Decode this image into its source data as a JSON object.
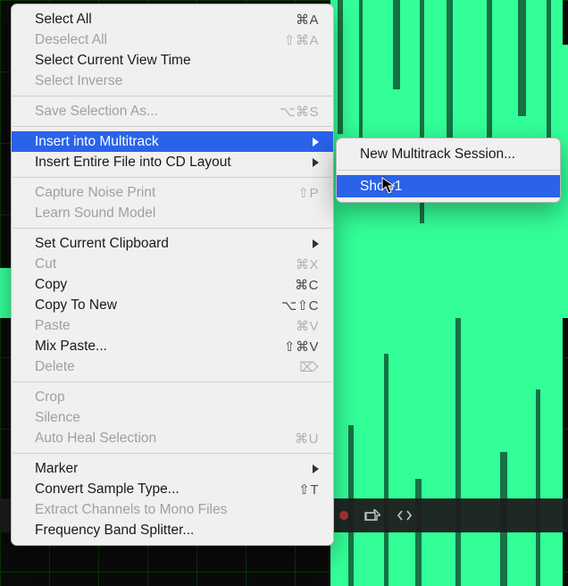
{
  "colors": {
    "highlight": "#2a62ea",
    "waveform": "#33ff99",
    "grid": "#0a5a2a"
  },
  "menu": {
    "groups": [
      [
        {
          "label": "Select All",
          "shortcut": "⌘A",
          "enabled": true
        },
        {
          "label": "Deselect All",
          "shortcut": "⇧⌘A",
          "enabled": false
        },
        {
          "label": "Select Current View Time",
          "shortcut": "",
          "enabled": true
        },
        {
          "label": "Select Inverse",
          "shortcut": "",
          "enabled": false
        }
      ],
      [
        {
          "label": "Save Selection As...",
          "shortcut": "⌥⌘S",
          "enabled": false
        }
      ],
      [
        {
          "label": "Insert into Multitrack",
          "shortcut": "",
          "enabled": true,
          "submenu": true,
          "highlighted": true
        },
        {
          "label": "Insert Entire File into CD Layout",
          "shortcut": "",
          "enabled": true,
          "submenu": true
        }
      ],
      [
        {
          "label": "Capture Noise Print",
          "shortcut": "⇧P",
          "enabled": false
        },
        {
          "label": "Learn Sound Model",
          "shortcut": "",
          "enabled": false
        }
      ],
      [
        {
          "label": "Set Current Clipboard",
          "shortcut": "",
          "enabled": true,
          "submenu": true
        },
        {
          "label": "Cut",
          "shortcut": "⌘X",
          "enabled": false
        },
        {
          "label": "Copy",
          "shortcut": "⌘C",
          "enabled": true
        },
        {
          "label": "Copy To New",
          "shortcut": "⌥⇧C",
          "enabled": true
        },
        {
          "label": "Paste",
          "shortcut": "⌘V",
          "enabled": false
        },
        {
          "label": "Mix Paste...",
          "shortcut": "⇧⌘V",
          "enabled": true
        },
        {
          "label": "Delete",
          "shortcut": "⌦",
          "enabled": false
        }
      ],
      [
        {
          "label": "Crop",
          "shortcut": "",
          "enabled": false
        },
        {
          "label": "Silence",
          "shortcut": "",
          "enabled": false
        },
        {
          "label": "Auto Heal Selection",
          "shortcut": "⌘U",
          "enabled": false
        }
      ],
      [
        {
          "label": "Marker",
          "shortcut": "",
          "enabled": true,
          "submenu": true
        },
        {
          "label": "Convert Sample Type...",
          "shortcut": "⇧T",
          "enabled": true
        },
        {
          "label": "Extract Channels to Mono Files",
          "shortcut": "",
          "enabled": false
        },
        {
          "label": "Frequency Band Splitter...",
          "shortcut": "",
          "enabled": true
        }
      ]
    ]
  },
  "submenu": {
    "items": [
      {
        "label": "New Multitrack Session...",
        "enabled": true,
        "highlighted": false
      },
      {
        "label": "Show1",
        "enabled": true,
        "highlighted": true
      }
    ]
  }
}
